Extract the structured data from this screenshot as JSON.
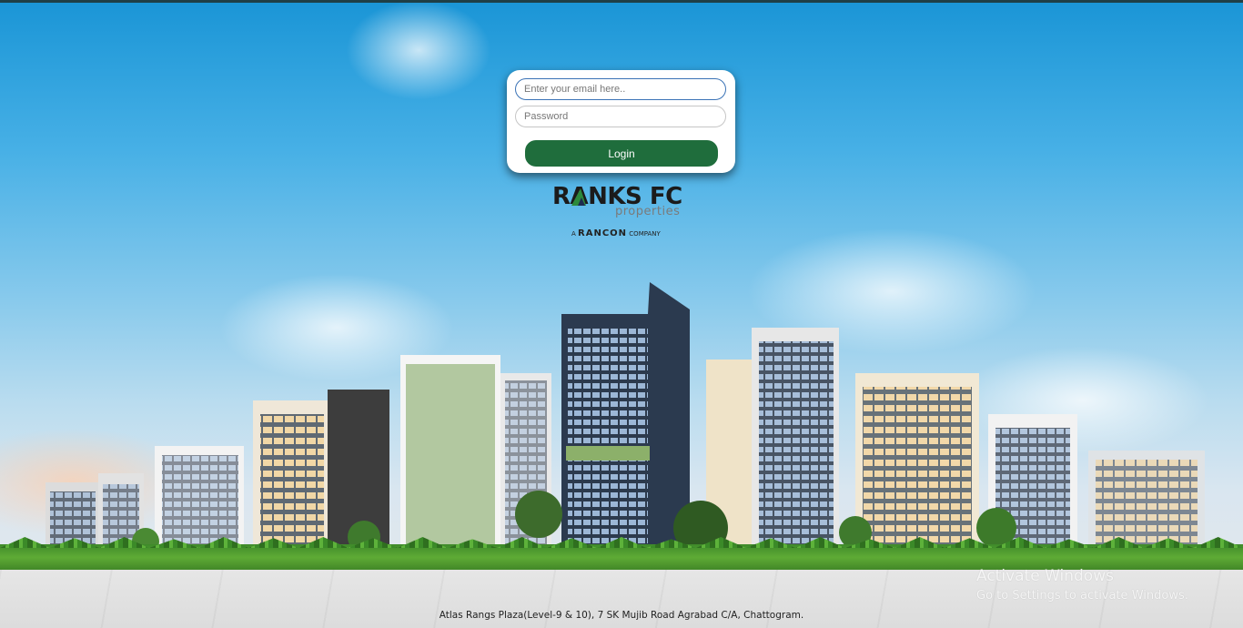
{
  "login": {
    "email_placeholder": "Enter your email here..",
    "email_value": "",
    "password_placeholder": "Password",
    "password_value": "",
    "login_label": "Login"
  },
  "logo": {
    "brand_main": "RANKS FC",
    "brand_sub": "properties",
    "tag_prefix": "A",
    "tag_company": "RANCON",
    "tag_suffix": "COMPANY"
  },
  "footer": {
    "address": "Atlas Rangs Plaza(Level-9 & 10), 7 SK Mujib Road Agrabad C/A, Chattogram."
  },
  "watermark": {
    "line1": "Activate Windows",
    "line2": "Go to Settings to activate Windows."
  },
  "colors": {
    "login_button": "#1f6d3c",
    "email_focus_border": "#3b73b6",
    "logo_green": "#2c8a3c",
    "logo_navy": "#1d2b4f"
  }
}
